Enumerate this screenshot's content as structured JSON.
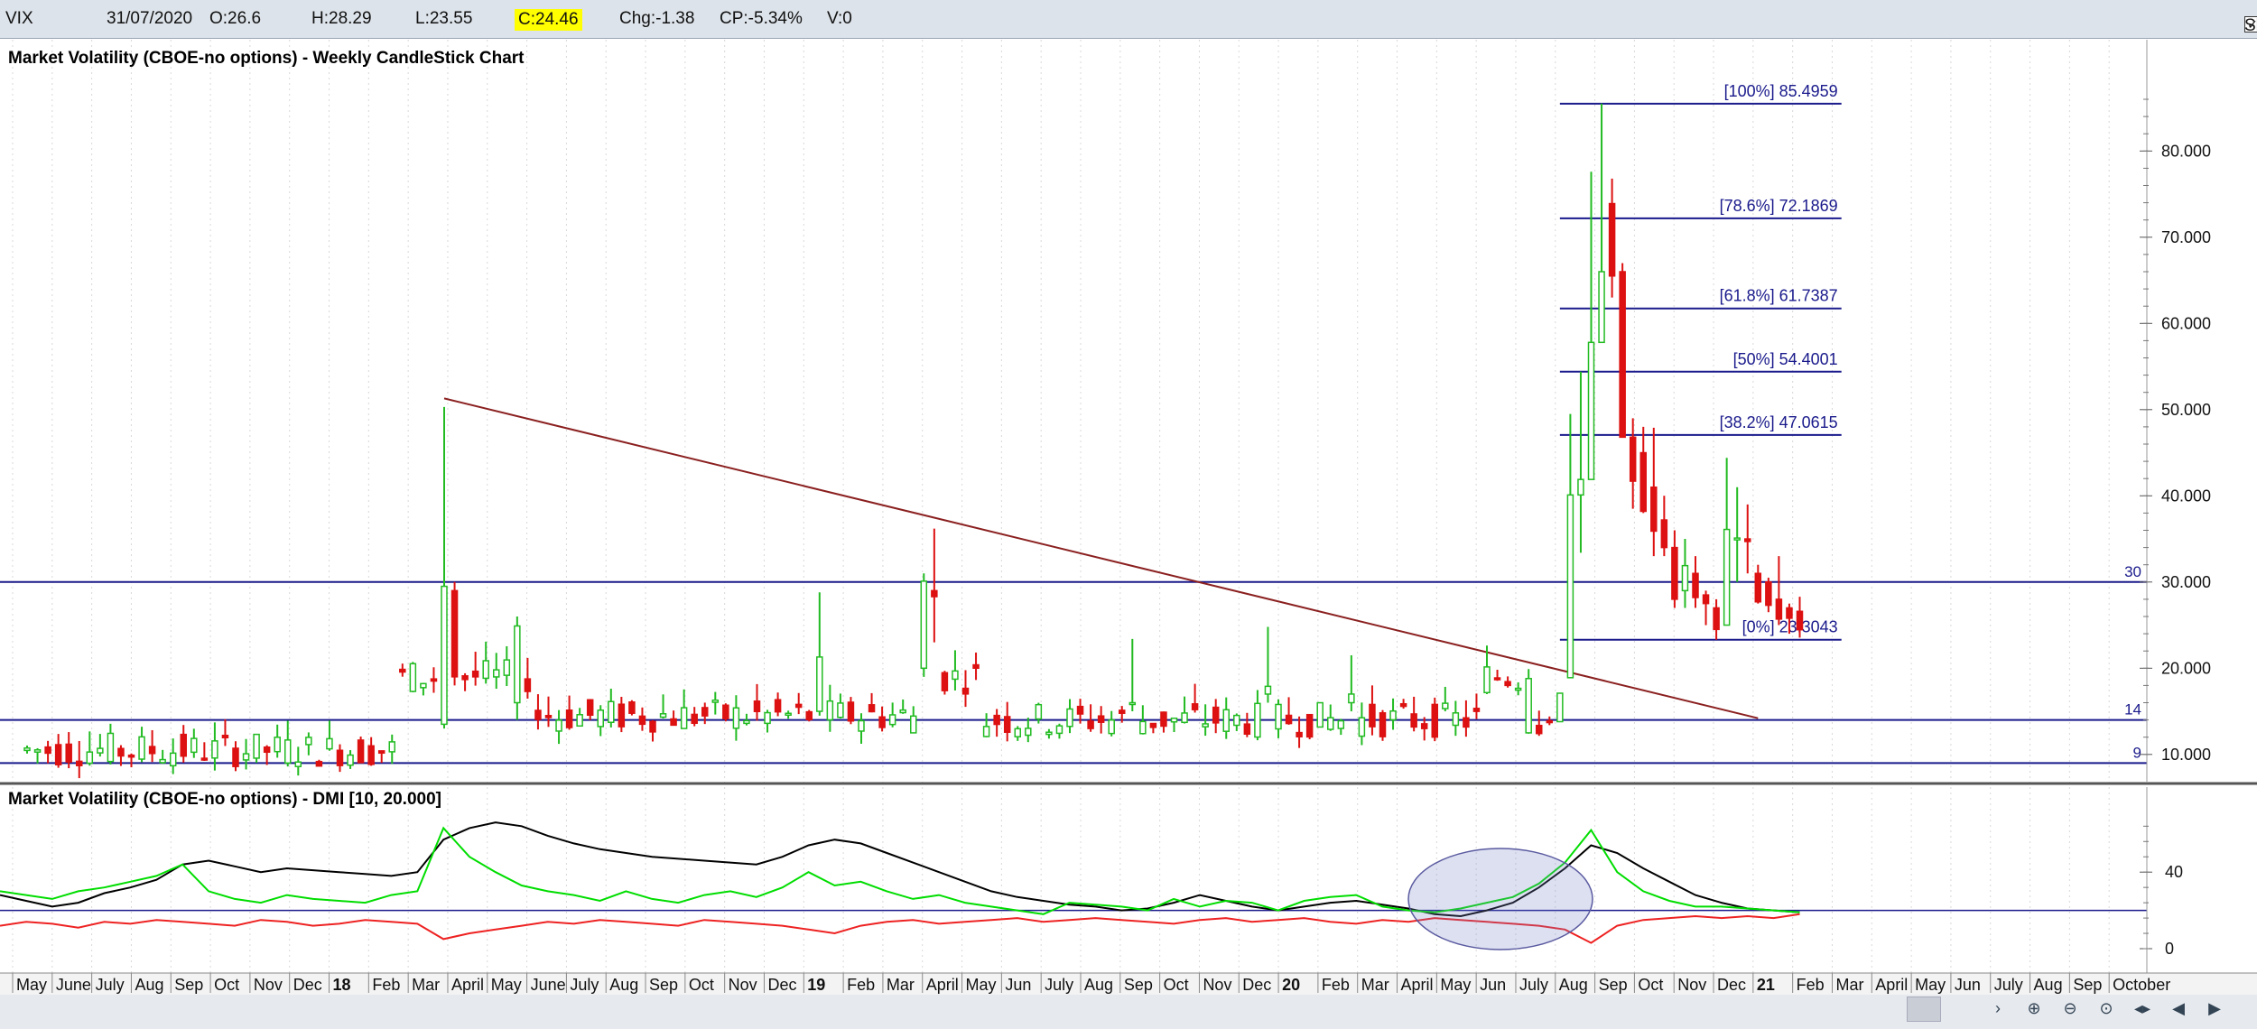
{
  "quote": {
    "symbol": "VIX",
    "date": "31/07/2020",
    "open": "O:26.6",
    "high": "H:28.29",
    "low": "L:23.55",
    "close": "C:24.46",
    "change": "Chg:-1.38",
    "change_pct": "CP:-5.34%",
    "volume": "V:0",
    "show_last_label": "Show Last",
    "show_last_checked": true,
    "close_highlight_color": "#ffff00"
  },
  "chart_data": [
    {
      "type": "candlestick",
      "title": "Market Volatility (CBOE-no options) - Weekly CandleStick Chart",
      "ylim": [
        8,
        90
      ],
      "y_ticks": [
        "10.000",
        "20.000",
        "30.000",
        "40.000",
        "50.000",
        "60.000",
        "70.000",
        "80.000"
      ],
      "colors": {
        "up": "#22bb22",
        "down": "#dd1111",
        "trendline": "#8b2020",
        "hline": "#1a1a8c",
        "fib": "#1a1a8c"
      },
      "horizontal_lines": [
        {
          "value": 30,
          "label": "30"
        },
        {
          "value": 14,
          "label": "14"
        },
        {
          "value": 9,
          "label": "9"
        }
      ],
      "trendline": {
        "from": {
          "date": "2018-02-02",
          "value": 51.3
        },
        "to": {
          "date": "2020-07-03",
          "value": 14.2
        }
      },
      "fibonacci": [
        {
          "label": "[100%] 85.4959",
          "value": 85.4959
        },
        {
          "label": "[78.6%] 72.1869",
          "value": 72.1869
        },
        {
          "label": "[61.8%] 61.7387",
          "value": 61.7387
        },
        {
          "label": "[50%] 54.4001",
          "value": 54.4001
        },
        {
          "label": "[38.2%] 47.0615",
          "value": 47.0615
        },
        {
          "label": "[0%] 23.3043",
          "value": 23.3043
        }
      ],
      "fib_span": {
        "from": "2020-02-21",
        "to": "2020-08-28"
      },
      "ohlc": [
        {
          "date": "2020-02-14",
          "open": 13.9,
          "high": 14.4,
          "low": 13.4,
          "close": 13.7
        },
        {
          "date": "2020-02-21",
          "open": 13.8,
          "high": 17.1,
          "low": 13.8,
          "close": 17.1
        },
        {
          "date": "2020-02-28",
          "open": 18.9,
          "high": 49.5,
          "low": 18.9,
          "close": 40.1
        },
        {
          "date": "2020-03-06",
          "open": 40.1,
          "high": 54.4,
          "low": 33.4,
          "close": 41.9
        },
        {
          "date": "2020-03-13",
          "open": 41.9,
          "high": 77.6,
          "low": 41.9,
          "close": 57.8
        },
        {
          "date": "2020-03-20",
          "open": 57.8,
          "high": 85.5,
          "low": 57.8,
          "close": 66.0
        },
        {
          "date": "2020-03-27",
          "open": 73.9,
          "high": 76.8,
          "low": 63.0,
          "close": 65.5
        },
        {
          "date": "2020-04-03",
          "open": 66.0,
          "high": 67.0,
          "low": 47.0,
          "close": 46.8
        },
        {
          "date": "2020-04-10",
          "open": 46.8,
          "high": 49.0,
          "low": 38.5,
          "close": 41.7
        },
        {
          "date": "2020-04-17",
          "open": 45.0,
          "high": 48.0,
          "low": 38.0,
          "close": 38.2
        },
        {
          "date": "2020-04-24",
          "open": 41.0,
          "high": 47.9,
          "low": 33.0,
          "close": 35.9
        },
        {
          "date": "2020-05-01",
          "open": 37.2,
          "high": 40.0,
          "low": 33.0,
          "close": 34.0
        },
        {
          "date": "2020-05-08",
          "open": 34.0,
          "high": 36.0,
          "low": 27.0,
          "close": 28.0
        },
        {
          "date": "2020-05-15",
          "open": 29.0,
          "high": 35.0,
          "low": 27.0,
          "close": 31.9
        },
        {
          "date": "2020-05-22",
          "open": 31.0,
          "high": 33.0,
          "low": 27.0,
          "close": 28.2
        },
        {
          "date": "2020-05-29",
          "open": 28.5,
          "high": 29.0,
          "low": 25.0,
          "close": 27.5
        },
        {
          "date": "2020-06-05",
          "open": 27.0,
          "high": 28.0,
          "low": 23.3,
          "close": 24.5
        },
        {
          "date": "2020-06-12",
          "open": 25.0,
          "high": 44.4,
          "low": 25.0,
          "close": 36.1
        },
        {
          "date": "2020-06-19",
          "open": 35.0,
          "high": 41.0,
          "low": 30.0,
          "close": 35.1
        },
        {
          "date": "2020-06-26",
          "open": 35.0,
          "high": 39.0,
          "low": 31.0,
          "close": 34.7
        },
        {
          "date": "2020-07-03",
          "open": 31.0,
          "high": 32.0,
          "low": 27.5,
          "close": 27.7
        },
        {
          "date": "2020-07-10",
          "open": 30.0,
          "high": 30.5,
          "low": 26.5,
          "close": 27.3
        },
        {
          "date": "2020-07-17",
          "open": 28.0,
          "high": 33.0,
          "low": 25.0,
          "close": 25.7
        },
        {
          "date": "2020-07-24",
          "open": 27.0,
          "high": 27.5,
          "low": 24.0,
          "close": 25.8
        },
        {
          "date": "2020-07-31",
          "open": 26.6,
          "high": 28.29,
          "low": 23.55,
          "close": 24.46
        }
      ]
    },
    {
      "type": "line",
      "title": "Market Volatility (CBOE-no options) - DMI [10, 20.000]",
      "ylim": [
        -8,
        72
      ],
      "y_ticks": [
        "0",
        "40"
      ],
      "horizontal_lines": [
        {
          "value": 20
        }
      ],
      "series": [
        {
          "color": "#000000",
          "values": [
            28,
            25,
            22,
            24,
            29,
            32,
            36,
            44,
            46,
            43,
            40,
            42,
            41,
            40,
            39,
            38,
            40,
            57,
            63,
            66,
            64,
            59,
            55,
            52,
            50,
            48,
            47,
            46,
            45,
            44,
            48,
            54,
            57,
            55,
            50,
            45,
            40,
            35,
            30,
            27,
            25,
            23,
            22,
            20,
            21,
            24,
            28,
            25,
            22,
            20,
            22,
            24,
            25,
            23,
            21,
            18,
            17,
            20,
            24,
            32,
            42,
            54,
            50,
            42,
            35,
            28,
            24,
            21,
            20,
            19
          ]
        },
        {
          "color": "#00dd00",
          "values": [
            30,
            28,
            26,
            30,
            32,
            35,
            38,
            44,
            30,
            26,
            24,
            28,
            26,
            25,
            24,
            28,
            30,
            63,
            48,
            40,
            33,
            30,
            28,
            25,
            30,
            26,
            24,
            28,
            30,
            27,
            32,
            40,
            33,
            35,
            30,
            26,
            28,
            24,
            22,
            20,
            18,
            24,
            23,
            22,
            20,
            26,
            22,
            25,
            24,
            20,
            25,
            27,
            28,
            22,
            20,
            19,
            21,
            24,
            27,
            34,
            45,
            62,
            40,
            30,
            25,
            22,
            22,
            21,
            20,
            19
          ]
        },
        {
          "color": "#ee2222",
          "values": [
            12,
            14,
            13,
            11,
            14,
            13,
            15,
            14,
            13,
            12,
            15,
            14,
            12,
            13,
            15,
            14,
            13,
            5,
            8,
            10,
            12,
            14,
            13,
            15,
            14,
            13,
            12,
            15,
            14,
            13,
            12,
            10,
            8,
            12,
            14,
            15,
            13,
            14,
            15,
            16,
            14,
            15,
            16,
            15,
            14,
            13,
            15,
            16,
            14,
            15,
            16,
            14,
            13,
            15,
            14,
            16,
            15,
            14,
            13,
            12,
            10,
            3,
            12,
            15,
            16,
            17,
            16,
            17,
            16,
            18
          ]
        }
      ],
      "highlight": "ellipse"
    }
  ],
  "x_axis": {
    "labels": [
      "May",
      "June",
      "July",
      "Aug",
      "Sep",
      "Oct",
      "Nov",
      "Dec",
      "18",
      "Feb",
      "Mar",
      "April",
      "May",
      "June",
      "July",
      "Aug",
      "Sep",
      "Oct",
      "Nov",
      "Dec",
      "19",
      "Feb",
      "Mar",
      "April",
      "May",
      "Jun",
      "July",
      "Aug",
      "Sep",
      "Oct",
      "Nov",
      "Dec",
      "20",
      "Feb",
      "Mar",
      "April",
      "May",
      "Jun",
      "July",
      "Aug",
      "Sep",
      "Oct",
      "Nov",
      "Dec",
      "21",
      "Feb",
      "Mar",
      "April",
      "May",
      "Jun",
      "July",
      "Aug",
      "Sep",
      "October"
    ],
    "bold_labels": [
      "18",
      "19",
      "20",
      "21"
    ]
  },
  "nav": {
    "icons": [
      "chevron-right-icon",
      "zoom-in-icon",
      "zoom-out-icon",
      "zoom-reset-icon",
      "scroll-both-icon",
      "arrow-left-icon",
      "arrow-right-icon"
    ]
  }
}
